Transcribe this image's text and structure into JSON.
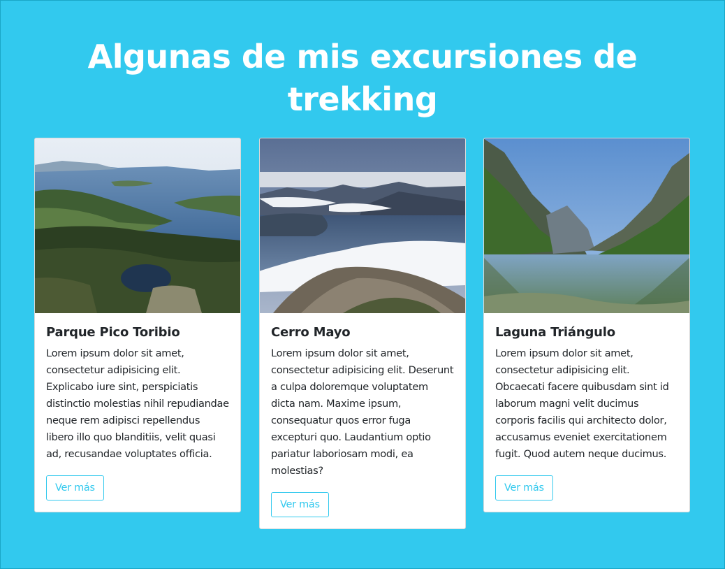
{
  "page": {
    "heading": "Algunas de mis excursiones de trekking"
  },
  "colors": {
    "background": "#32c9ee",
    "accent": "#32c9ee",
    "text": "#212529"
  },
  "cards": [
    {
      "image": "lake-landscape-photo",
      "title": "Parque Pico Toribio",
      "text": "Lorem ipsum dolor sit amet, consectetur adipisicing elit. Explicabo iure sint, perspiciatis distinctio molestias nihil repudiandae neque rem adipisci repellendus libero illo quo blanditiis, velit quasi ad, recusandae voluptates officia.",
      "button": "Ver más"
    },
    {
      "image": "mountain-summit-photo",
      "title": "Cerro Mayo",
      "text": "Lorem ipsum dolor sit amet, consectetur adipisicing elit. Deserunt a culpa doloremque voluptatem dicta nam. Maxime ipsum, consequatur quos error fuga excepturi quo. Laudantium optio pariatur laboriosam modi, ea molestias?",
      "button": "Ver más"
    },
    {
      "image": "valley-lagoon-photo",
      "title": "Laguna Triángulo",
      "text": "Lorem ipsum dolor sit amet, consectetur adipisicing elit. Obcaecati facere quibusdam sint id laborum magni velit ducimus corporis facilis qui architecto dolor, accusamus eveniet exercitationem fugit. Quod autem neque ducimus.",
      "button": "Ver más"
    }
  ]
}
